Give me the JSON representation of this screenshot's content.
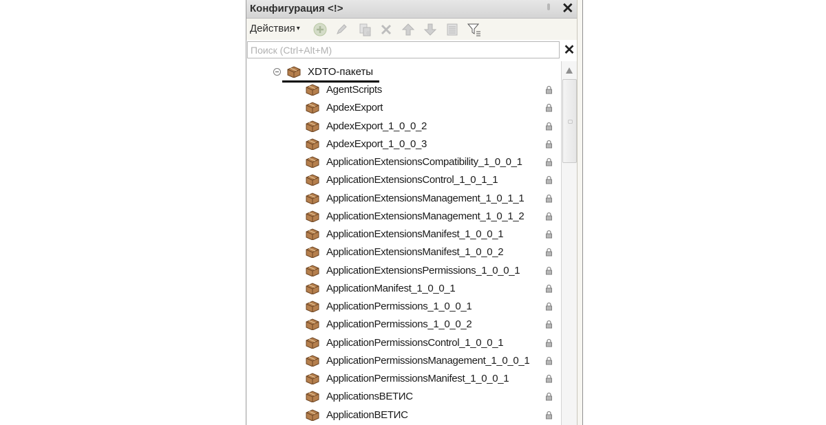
{
  "panel": {
    "title": "Конфигурация <!>",
    "close_glyph": "✕"
  },
  "toolbar": {
    "actions_label": "Действия",
    "actions_caret": "▾",
    "buttons": [
      {
        "name": "add-icon",
        "color": "#b9c8a4"
      },
      {
        "name": "edit-icon",
        "color": "#bcbcbc"
      },
      {
        "name": "copy-icon",
        "color": "#c3c3c3"
      },
      {
        "name": "delete-icon",
        "color": "#bdbdbd"
      },
      {
        "name": "move-up-icon",
        "color": "#bfbfbf"
      },
      {
        "name": "move-down-icon",
        "color": "#bfbfbf"
      },
      {
        "name": "list-icon",
        "color": "#bdbdbd"
      },
      {
        "name": "filter-icon",
        "color": "#666666"
      }
    ]
  },
  "search": {
    "placeholder": "Поиск (Ctrl+Alt+M)",
    "value": "",
    "clear_glyph": "✕"
  },
  "tree": {
    "root": {
      "label": "XDTO-пакеты",
      "expanded": true
    },
    "items": [
      "AgentScripts",
      "ApdexExport",
      "ApdexExport_1_0_0_2",
      "ApdexExport_1_0_0_3",
      "ApplicationExtensionsCompatibility_1_0_0_1",
      "ApplicationExtensionsControl_1_0_1_1",
      "ApplicationExtensionsManagement_1_0_1_1",
      "ApplicationExtensionsManagement_1_0_1_2",
      "ApplicationExtensionsManifest_1_0_0_1",
      "ApplicationExtensionsManifest_1_0_0_2",
      "ApplicationExtensionsPermissions_1_0_0_1",
      "ApplicationManifest_1_0_0_1",
      "ApplicationPermissions_1_0_0_1",
      "ApplicationPermissions_1_0_0_2",
      "ApplicationPermissionsControl_1_0_0_1",
      "ApplicationPermissionsManagement_1_0_0_1",
      "ApplicationPermissionsManifest_1_0_0_1",
      "ApplicationsВЕТИС",
      "ApplicationВЕТИС"
    ],
    "item_icon": "package-icon",
    "item_status_icon": "lock-icon"
  },
  "colors": {
    "title_bar": "#d9d9d9",
    "toolbar_bg": "#f6f5ef",
    "package_icon": "#9b6a3c",
    "lock_icon": "#8a8a8a"
  }
}
